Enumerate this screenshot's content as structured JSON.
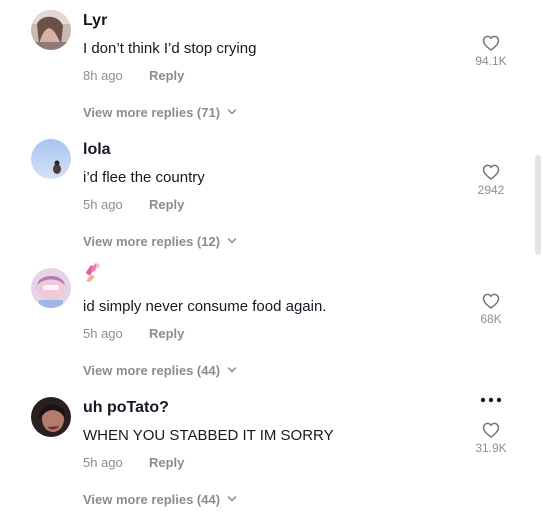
{
  "comments": [
    {
      "username": "Lyr",
      "avatar": "avatar-photo",
      "text": "I don’t think I’d stop crying",
      "time": "8h ago",
      "reply_label": "Reply",
      "likes": "94.1K",
      "view_more": "View more replies (71)"
    },
    {
      "username": "lola",
      "avatar": "avatar-photo",
      "text": "i’d flee the country",
      "time": "5h ago",
      "reply_label": "Reply",
      "likes": "2942",
      "view_more": "View more replies (12)"
    },
    {
      "username": "",
      "username_emoji": "nail-polish-emoji",
      "avatar": "avatar-photo",
      "text": "id simply never consume food again.",
      "time": "5h ago",
      "reply_label": "Reply",
      "likes": "68K",
      "view_more": "View more replies (44)"
    },
    {
      "username": "uh poTato?",
      "avatar": "avatar-photo",
      "text": "WHEN YOU STABBED IT IM SORRY",
      "time": "5h ago",
      "reply_label": "Reply",
      "likes": "31.9K",
      "view_more": "View more replies (44)"
    }
  ],
  "icons": {
    "like": "heart-outline-icon",
    "expand": "chevron-down-icon",
    "more": "more-options-icon"
  },
  "colors": {
    "primary_text": "#161823",
    "secondary_text": "#8a8b91",
    "background": "#ffffff"
  }
}
